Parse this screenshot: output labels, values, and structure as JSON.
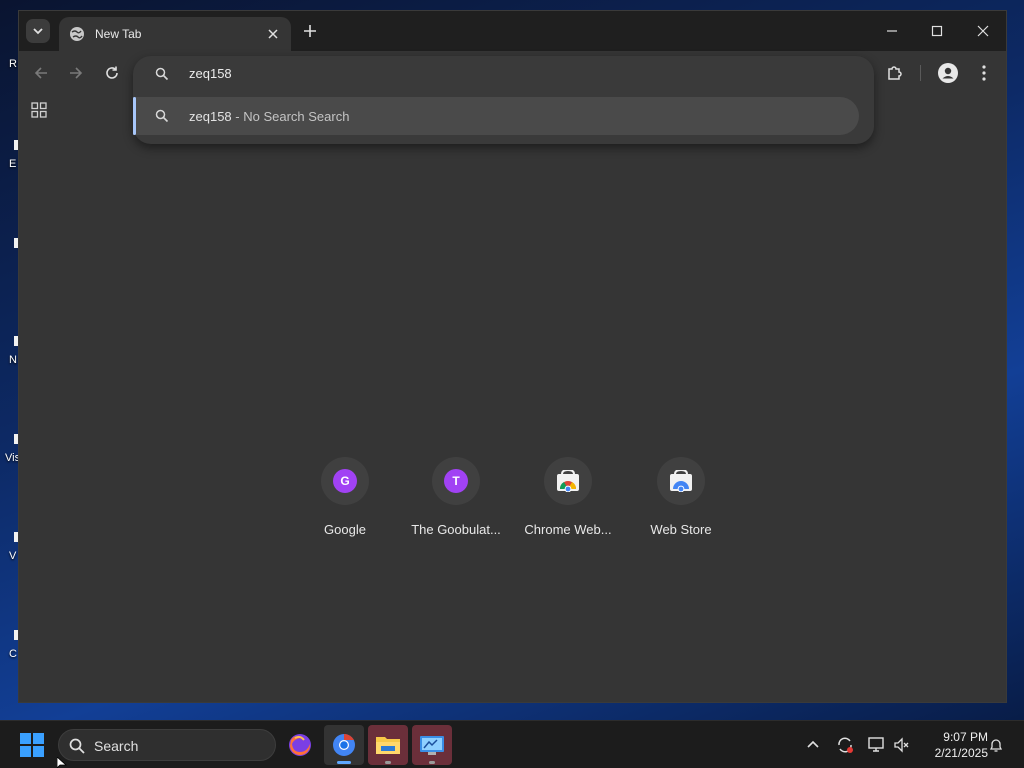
{
  "desktop": {
    "icon_labels": [
      "R",
      "E",
      "N",
      "Vis",
      "V",
      "C"
    ]
  },
  "browser": {
    "tab": {
      "title": "New Tab"
    },
    "omnibox": {
      "input_value": "zeq158",
      "suggestion": {
        "query": "zeq158",
        "separator": " - ",
        "engine": "No Search Search"
      }
    },
    "shortcuts": [
      {
        "letter": "G",
        "label": "Google",
        "icon": "letter-avatar"
      },
      {
        "letter": "T",
        "label": "The Goobulat...",
        "icon": "letter-avatar"
      },
      {
        "letter": "",
        "label": "Chrome Web...",
        "icon": "web-store-icon"
      },
      {
        "letter": "",
        "label": "Web Store",
        "icon": "web-store-icon"
      }
    ],
    "colors": {
      "accent": "#a8c7fa",
      "avatar": "#a142f4",
      "surface": "#353535"
    }
  },
  "taskbar": {
    "search_label": "Search",
    "clock": {
      "time": "9:07 PM",
      "date": "2/21/2025"
    }
  }
}
